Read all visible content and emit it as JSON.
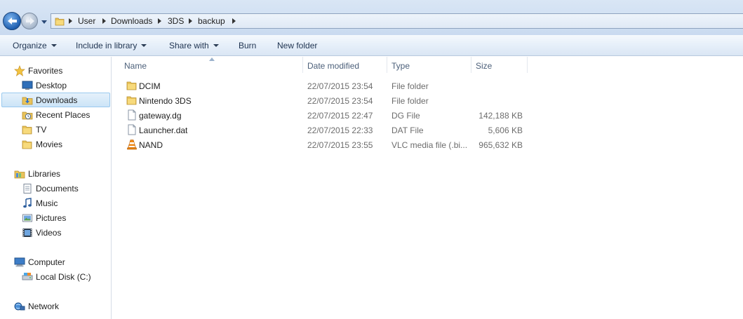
{
  "address_bar": {
    "crumbs": [
      "User",
      "Downloads",
      "3DS",
      "backup"
    ]
  },
  "toolbar": {
    "organize": "Organize",
    "include_in_library": "Include in library",
    "share_with": "Share with",
    "burn": "Burn",
    "new_folder": "New folder"
  },
  "nav": {
    "favorites": {
      "label": "Favorites",
      "items": [
        {
          "label": "Desktop",
          "icon": "desktop-icon"
        },
        {
          "label": "Downloads",
          "icon": "downloads-icon",
          "selected": true
        },
        {
          "label": "Recent Places",
          "icon": "recent-places-icon"
        },
        {
          "label": "TV",
          "icon": "folder-icon"
        },
        {
          "label": "Movies",
          "icon": "folder-icon"
        }
      ]
    },
    "libraries": {
      "label": "Libraries",
      "items": [
        {
          "label": "Documents",
          "icon": "documents-icon"
        },
        {
          "label": "Music",
          "icon": "music-icon"
        },
        {
          "label": "Pictures",
          "icon": "pictures-icon"
        },
        {
          "label": "Videos",
          "icon": "videos-icon"
        }
      ]
    },
    "computer": {
      "label": "Computer",
      "items": [
        {
          "label": "Local Disk (C:)",
          "icon": "drive-icon"
        }
      ]
    },
    "network": {
      "label": "Network"
    }
  },
  "columns": {
    "name": "Name",
    "date_modified": "Date modified",
    "type": "Type",
    "size": "Size"
  },
  "files": [
    {
      "name": "DCIM",
      "date": "22/07/2015 23:54",
      "type": "File folder",
      "size": "",
      "icon": "folder-icon"
    },
    {
      "name": "Nintendo 3DS",
      "date": "22/07/2015 23:54",
      "type": "File folder",
      "size": "",
      "icon": "folder-icon"
    },
    {
      "name": "gateway.dg",
      "date": "22/07/2015 22:47",
      "type": "DG File",
      "size": "142,188 KB",
      "icon": "file-icon"
    },
    {
      "name": "Launcher.dat",
      "date": "22/07/2015 22:33",
      "type": "DAT File",
      "size": "5,606 KB",
      "icon": "file-icon"
    },
    {
      "name": "NAND",
      "date": "22/07/2015 23:55",
      "type": "VLC media file (.bi...",
      "size": "965,632 KB",
      "icon": "vlc-icon"
    }
  ],
  "colors": {
    "accent_selection": "#cce4f7",
    "folder_yellow": "#f5d36c",
    "vlc_orange": "#f08a16"
  }
}
